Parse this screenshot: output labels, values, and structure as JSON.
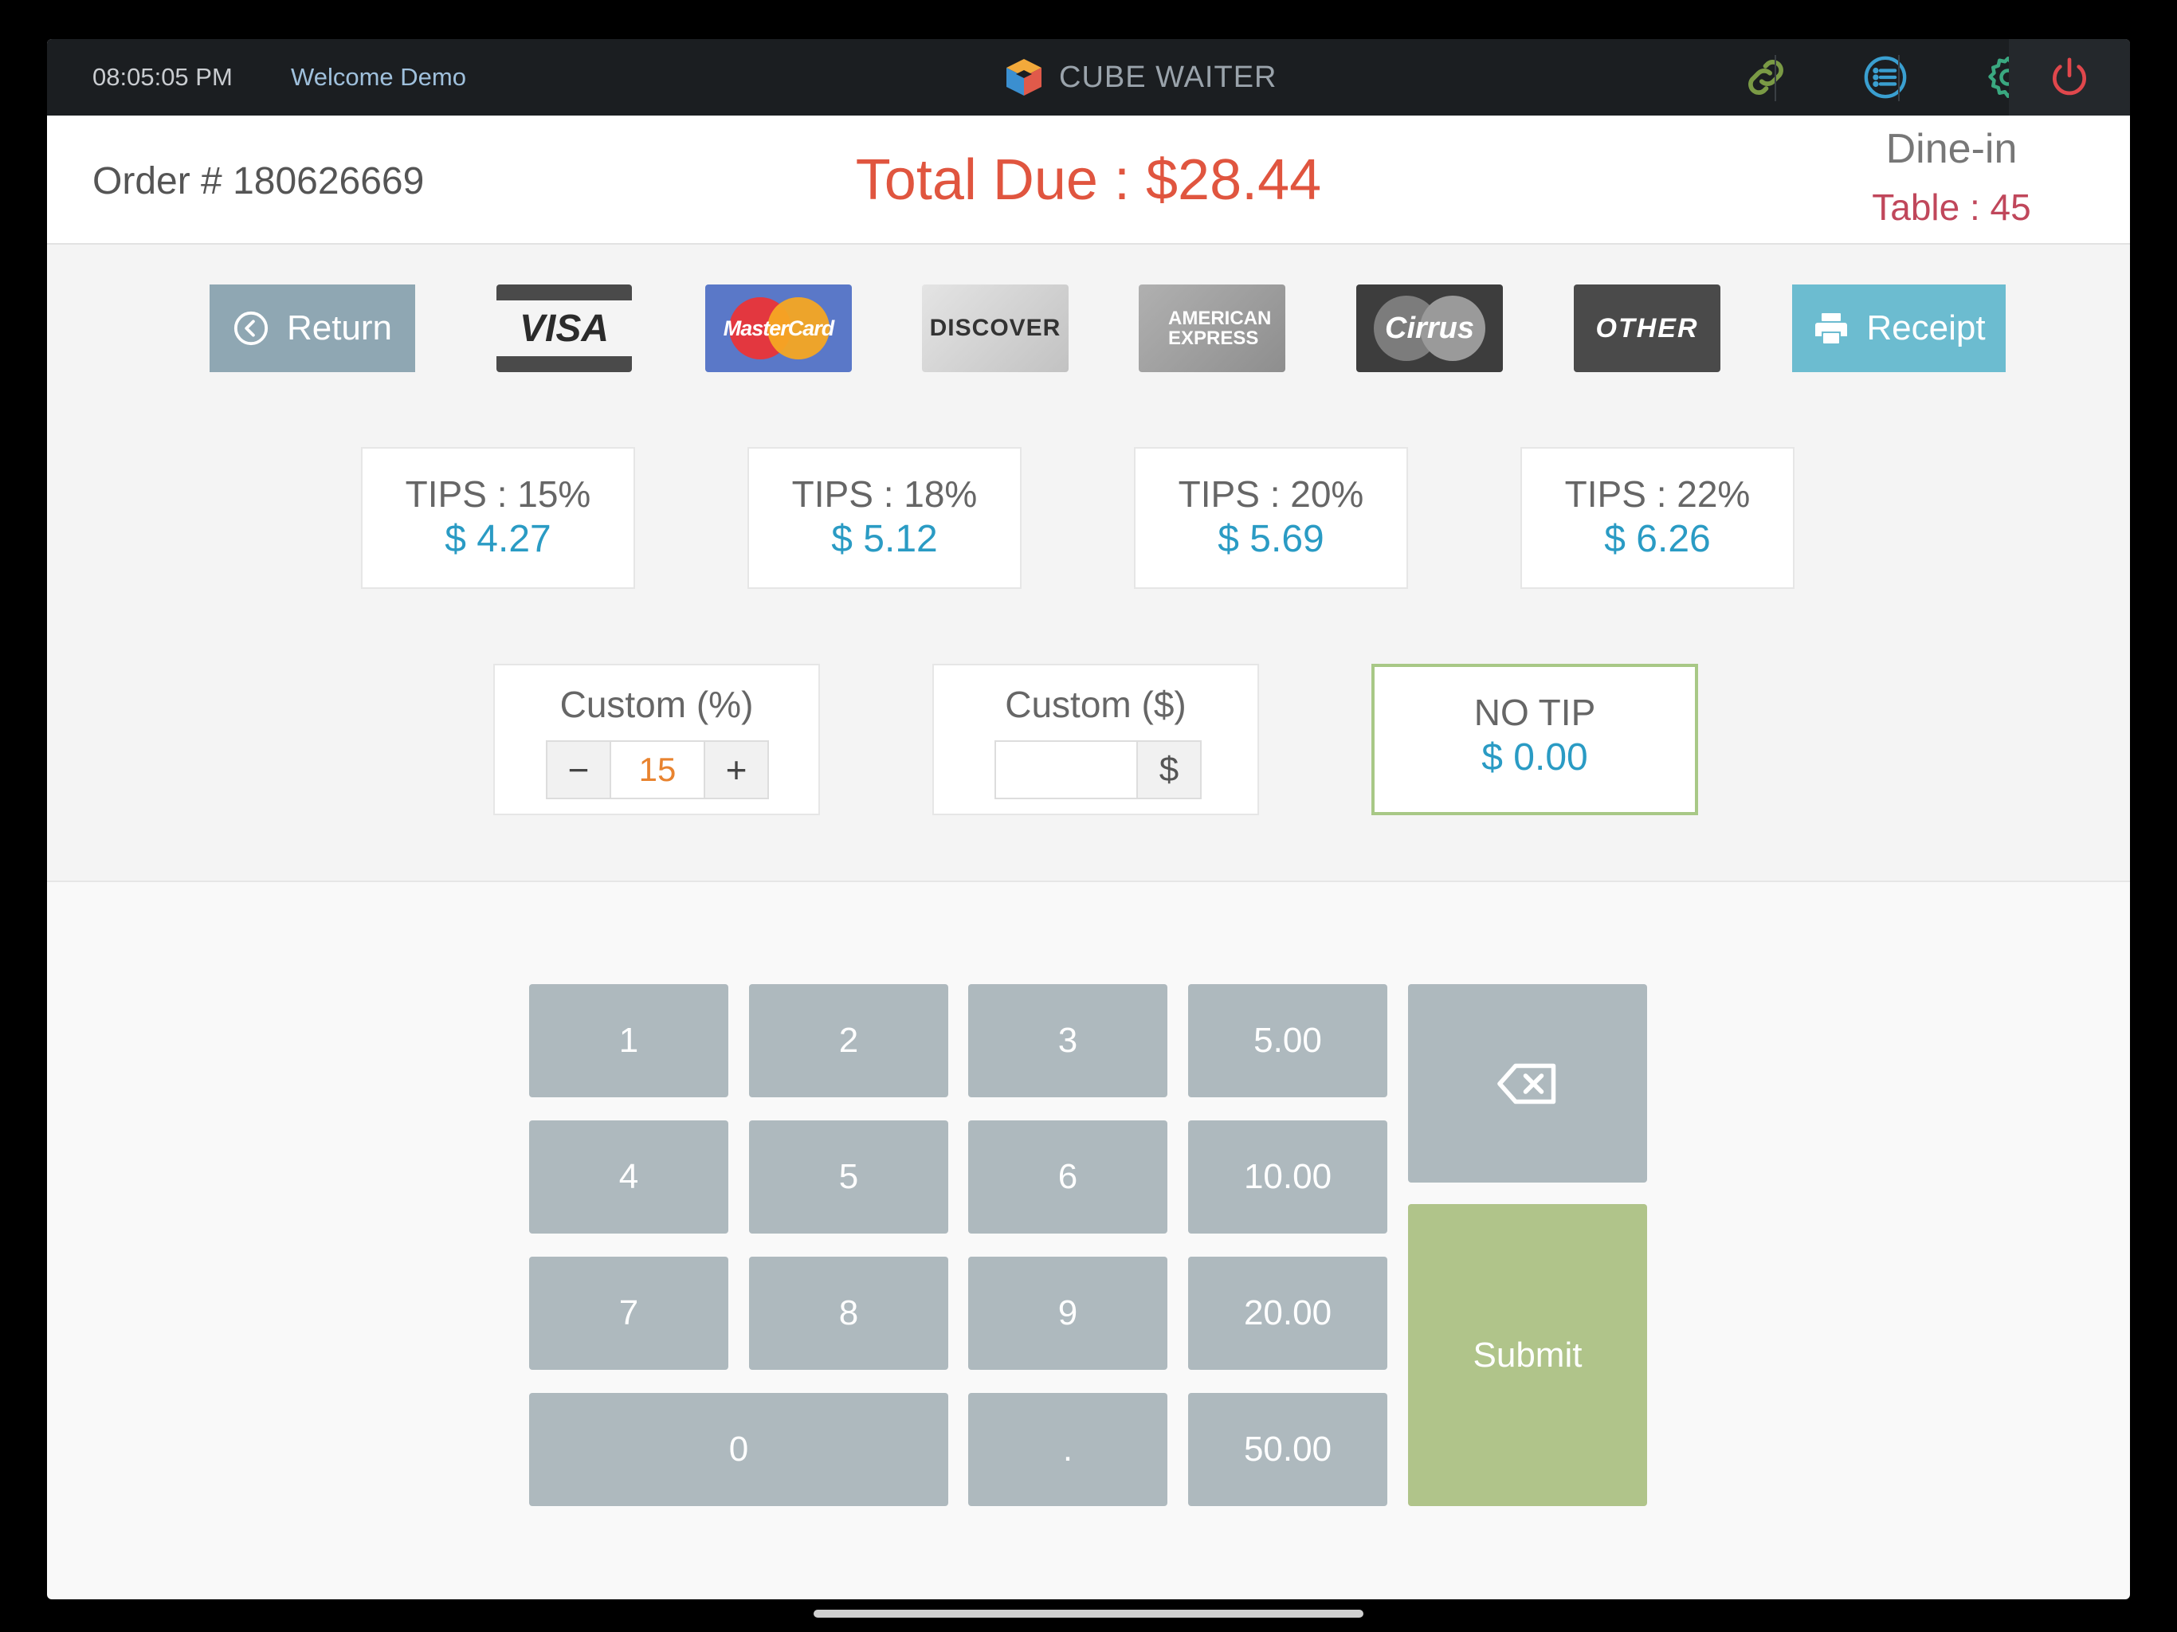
{
  "topbar": {
    "time": "08:05:05 PM",
    "welcome": "Welcome Demo",
    "app_name": "CUBE WAITER",
    "icons": [
      "link-icon",
      "list-icon",
      "gear-icon",
      "power-icon"
    ]
  },
  "header": {
    "order": "Order # 180626669",
    "total_due": "Total Due : $28.44",
    "order_type": "Dine-in",
    "table": "Table : 45"
  },
  "payment": {
    "return_label": "Return",
    "cards": [
      "VISA",
      "MasterCard",
      "DISCOVER",
      "AMERICAN EXPRESS",
      "Cirrus",
      "OTHER"
    ],
    "receipt_label": "Receipt"
  },
  "tips": [
    {
      "label": "TIPS : 15%",
      "amount": "$ 4.27"
    },
    {
      "label": "TIPS : 18%",
      "amount": "$ 5.12"
    },
    {
      "label": "TIPS : 20%",
      "amount": "$ 5.69"
    },
    {
      "label": "TIPS : 22%",
      "amount": "$ 6.26"
    }
  ],
  "custom_percent": {
    "title": "Custom (%)",
    "minus": "−",
    "value": "15",
    "plus": "+"
  },
  "custom_dollar": {
    "title": "Custom ($)",
    "value": "",
    "addon": "$"
  },
  "no_tip": {
    "label": "NO TIP",
    "amount": "$ 0.00"
  },
  "keypad": {
    "keys": [
      "1",
      "2",
      "3",
      "5.00",
      "4",
      "5",
      "6",
      "10.00",
      "7",
      "8",
      "9",
      "20.00",
      "0",
      ".",
      "50.00"
    ],
    "submit": "Submit"
  },
  "colors": {
    "total_due": "#e0553f",
    "tip_amount": "#2a9bc4",
    "table": "#c0475b",
    "keypad": "#aeb9be",
    "submit": "#b0c48a",
    "receipt": "#6cbcd0",
    "return": "#8fa7b3"
  }
}
